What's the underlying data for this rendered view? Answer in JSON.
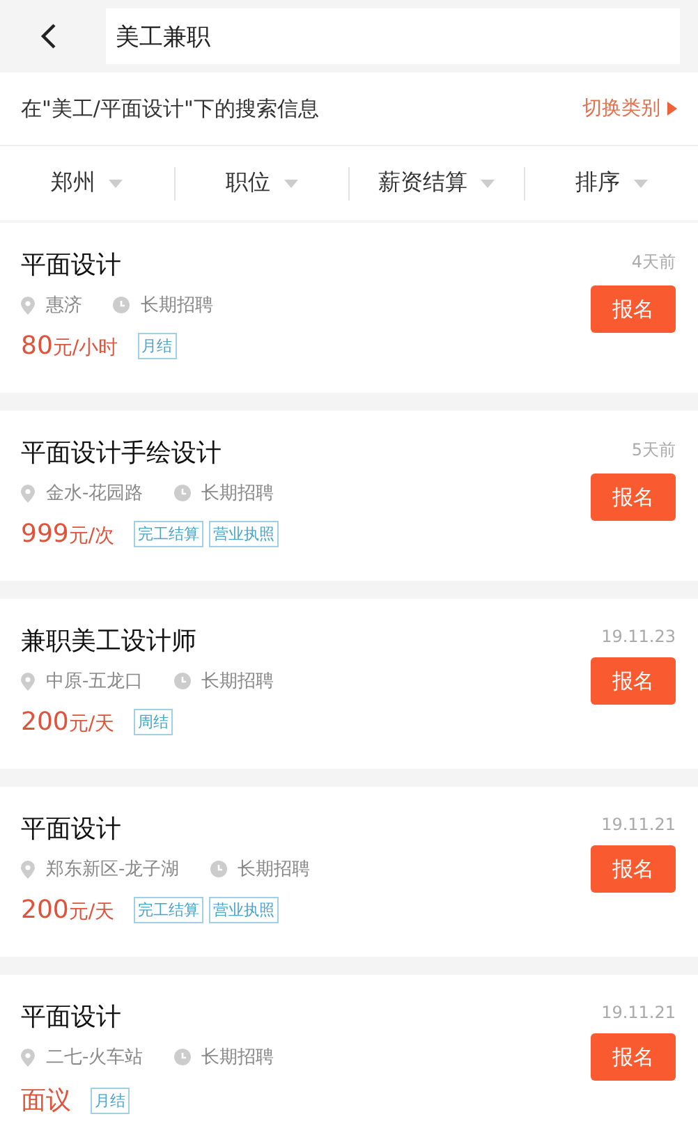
{
  "search": {
    "value": "美工兼职"
  },
  "category_bar": {
    "text": "在\"美工/平面设计\"下的搜索信息",
    "switch_link": "切换类别"
  },
  "filters": [
    {
      "label": "郑州"
    },
    {
      "label": "职位"
    },
    {
      "label": "薪资结算"
    },
    {
      "label": "排序"
    }
  ],
  "jobs": [
    {
      "title": "平面设计",
      "time": "4天前",
      "location": "惠济",
      "duration": "长期招聘",
      "salary": "80",
      "unit": "元/小时",
      "tags": [
        "月结"
      ],
      "button": "报名"
    },
    {
      "title": "平面设计手绘设计",
      "time": "5天前",
      "location": "金水-花园路",
      "duration": "长期招聘",
      "salary": "999",
      "unit": "元/次",
      "tags": [
        "完工结算",
        "营业执照"
      ],
      "button": "报名"
    },
    {
      "title": "兼职美工设计师",
      "time": "19.11.23",
      "location": "中原-五龙口",
      "duration": "长期招聘",
      "salary": "200",
      "unit": "元/天",
      "tags": [
        "周结"
      ],
      "button": "报名"
    },
    {
      "title": "平面设计",
      "time": "19.11.21",
      "location": "郑东新区-龙子湖",
      "duration": "长期招聘",
      "salary": "200",
      "unit": "元/天",
      "tags": [
        "完工结算",
        "营业执照"
      ],
      "button": "报名"
    },
    {
      "title": "平面设计",
      "time": "19.11.21",
      "location": "二七-火车站",
      "duration": "长期招聘",
      "salary": "面议",
      "tags": [
        "月结"
      ],
      "button": "报名"
    }
  ]
}
